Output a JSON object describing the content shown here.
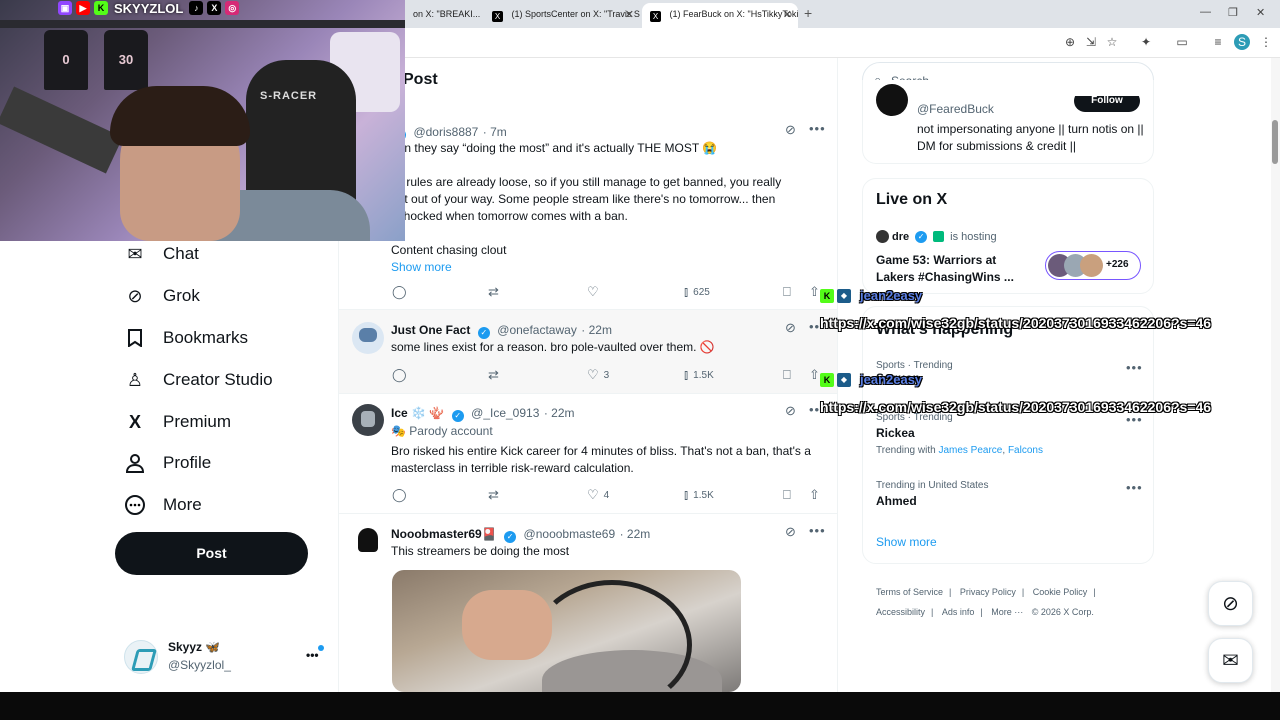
{
  "browser": {
    "tabs": [
      {
        "label": "on X: \"BREAKI...",
        "active": false
      },
      {
        "label": "(1) SportsCenter on X: \"Travis S...",
        "active": false
      },
      {
        "label": "(1) FearBuck on X: \"HsTikkyToki...",
        "active": true
      }
    ],
    "new_tab_icon": "plus-icon"
  },
  "stream_overlay": {
    "handle": "SKYYZLOL",
    "jersey_numbers": [
      "0",
      "30"
    ],
    "chair_brand": "S-RACER"
  },
  "left_nav": {
    "items": [
      {
        "label": "Chat",
        "icon": "envelope-icon"
      },
      {
        "label": "Grok",
        "icon": "grok-icon"
      },
      {
        "label": "Bookmarks",
        "icon": "bookmark-icon"
      },
      {
        "label": "Creator Studio",
        "icon": "creator-studio-icon"
      },
      {
        "label": "Premium",
        "icon": "x-logo-icon"
      },
      {
        "label": "Profile",
        "icon": "person-icon"
      },
      {
        "label": "More",
        "icon": "more-circle-icon"
      }
    ],
    "post_button": "Post",
    "account": {
      "name": "Skyyz 🦋",
      "handle": "@Skyyzlol_",
      "more": "•••"
    }
  },
  "main": {
    "title": "Post",
    "tweets": [
      {
        "handle": "@doris8887",
        "time": "· 7m",
        "lines": [
          "hen they say “doing the most” and it's actually THE MOST 😭",
          "ck rules are already loose, so if you still manage to get banned, you really",
          "ent out of your way. Some people stream like there's no tomorrow... then",
          "t shocked when tomorrow comes with a ban.",
          "Content chasing clout"
        ],
        "show_more": "Show more",
        "views": "625"
      },
      {
        "name": "Just One Fact",
        "handle": "@onefactaway",
        "time": "· 22m",
        "text": "some lines exist for a reason. bro pole-vaulted over them. 🚫",
        "likes": "3",
        "views": "1.5K"
      },
      {
        "name": "Ice ❄️ 🪸",
        "handle": "@_Ice_0913",
        "time": "· 22m",
        "parody": "Parody account",
        "text": "Bro risked his entire Kick career for 4 minutes of bliss. That's not a ban, that's a masterclass in terrible risk-reward calculation.",
        "likes": "4",
        "views": "1.5K"
      },
      {
        "name": "Nooobmaster69🎴",
        "handle": "@nooobmaste69",
        "time": "· 22m",
        "text": "This streamers be doing the most"
      }
    ]
  },
  "right": {
    "search_placeholder": "Search",
    "profile_card": {
      "handle": "@FearedBuck",
      "bio": "not impersonating anyone || turn notis on || DM for submissions & credit ||",
      "follow": "Follow"
    },
    "live": {
      "title": "Live on X",
      "host": "dre",
      "hosting": "is hosting",
      "event": "Game 53: Warriors at Lakers #ChasingWins ...",
      "count": "+226"
    },
    "happening": {
      "title": "What's happening",
      "trends": [
        {
          "meta": "Sports · Trending",
          "name": "Saquon",
          "with": ""
        },
        {
          "meta": "Sports · Trending",
          "name": "Rickea",
          "with_label": "Trending with",
          "with_links": [
            "James Pearce",
            "Falcons"
          ]
        },
        {
          "meta": "Trending in United States",
          "name": "Ahmed"
        }
      ],
      "show_more": "Show more"
    },
    "footer": [
      "Terms of Service",
      "Privacy Policy",
      "Cookie Policy",
      "Accessibility",
      "Ads info",
      "More ···",
      "© 2026 X Corp."
    ]
  },
  "chat_overlay": [
    {
      "user": "jean2easy",
      "message": "https://x.com/wise32gb/status/2020373016933462206?s=46"
    },
    {
      "user": "jean2easy",
      "message": "https://x.com/wise32gb/status/2020373016933462206?s=46"
    }
  ]
}
